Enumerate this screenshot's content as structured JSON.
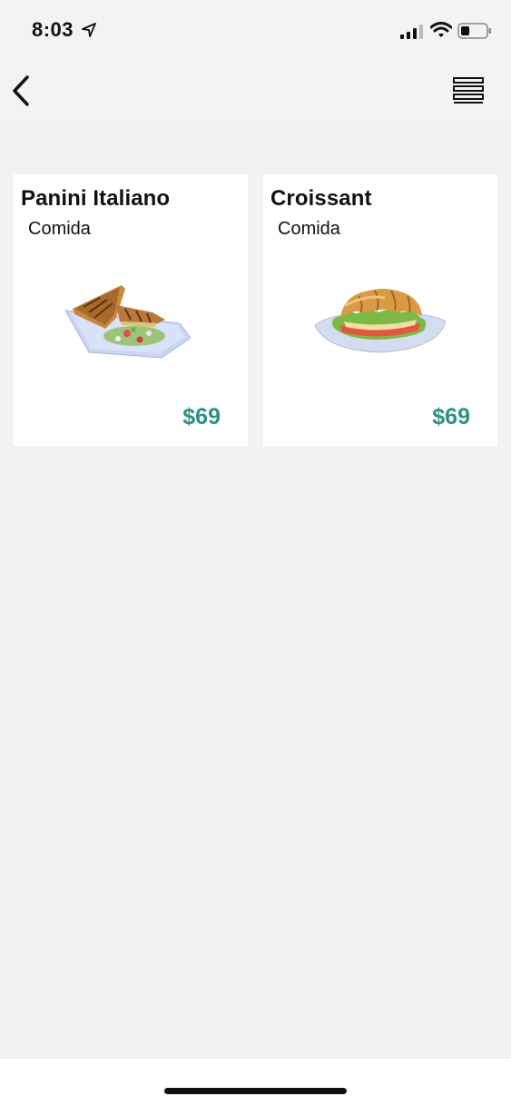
{
  "status_bar": {
    "time": "8:03",
    "icons": [
      "location-arrow-icon",
      "signal-icon",
      "wifi-icon",
      "battery-icon"
    ],
    "battery_level": 0.35
  },
  "nav": {
    "back_icon": "chevron-left-icon",
    "menu_icon": "hamburger-menu-icon"
  },
  "products": [
    {
      "name": "Panini Italiano",
      "category": "Comida",
      "price": "$69",
      "image_icon": "panini-image"
    },
    {
      "name": "Croissant",
      "category": "Comida",
      "price": "$69",
      "image_icon": "croissant-sandwich-image"
    }
  ],
  "colors": {
    "background": "#f2f2f2",
    "card": "#ffffff",
    "price": "#2e9080",
    "text": "#111111"
  }
}
